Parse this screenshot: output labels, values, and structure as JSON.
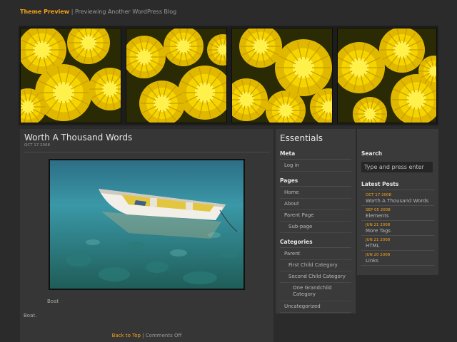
{
  "blog": {
    "title": "Theme Preview",
    "separator": "|",
    "tagline": "Previewing Another WordPress Blog"
  },
  "post": {
    "title": "Worth A Thousand Words",
    "date": "OCT 17 2008",
    "image_caption": "Boat",
    "body_text": "Boat.",
    "back_to_top": "Back to Top",
    "footer_sep": "|",
    "comments": "Comments Off"
  },
  "sidebar": {
    "title": "Essentials",
    "meta_heading": "Meta",
    "meta_items": [
      "Log in"
    ],
    "pages_heading": "Pages",
    "pages": [
      "Home",
      "About",
      "Parent Page",
      "Sub-page"
    ],
    "categories_heading": "Categories",
    "categories": [
      "Parent",
      "First Child Category",
      "Second Child Category",
      "One Grandchild Category",
      "Uncategorized"
    ]
  },
  "right_sidebar": {
    "search_heading": "Search",
    "search_placeholder": "Type and press enter",
    "latest_heading": "Latest Posts",
    "latest_posts": [
      {
        "date": "OCT 17 2008",
        "title": "Worth A Thousand Words"
      },
      {
        "date": "SEP 05 2008",
        "title": "Elements"
      },
      {
        "date": "JUN 21 2008",
        "title": "More Tags"
      },
      {
        "date": "JUN 21 2008",
        "title": "HTML"
      },
      {
        "date": "JUN 20 2008",
        "title": "Links"
      }
    ]
  },
  "colors": {
    "accent": "#f5a31a",
    "background": "#2b2b2b",
    "panel": "#363636"
  }
}
